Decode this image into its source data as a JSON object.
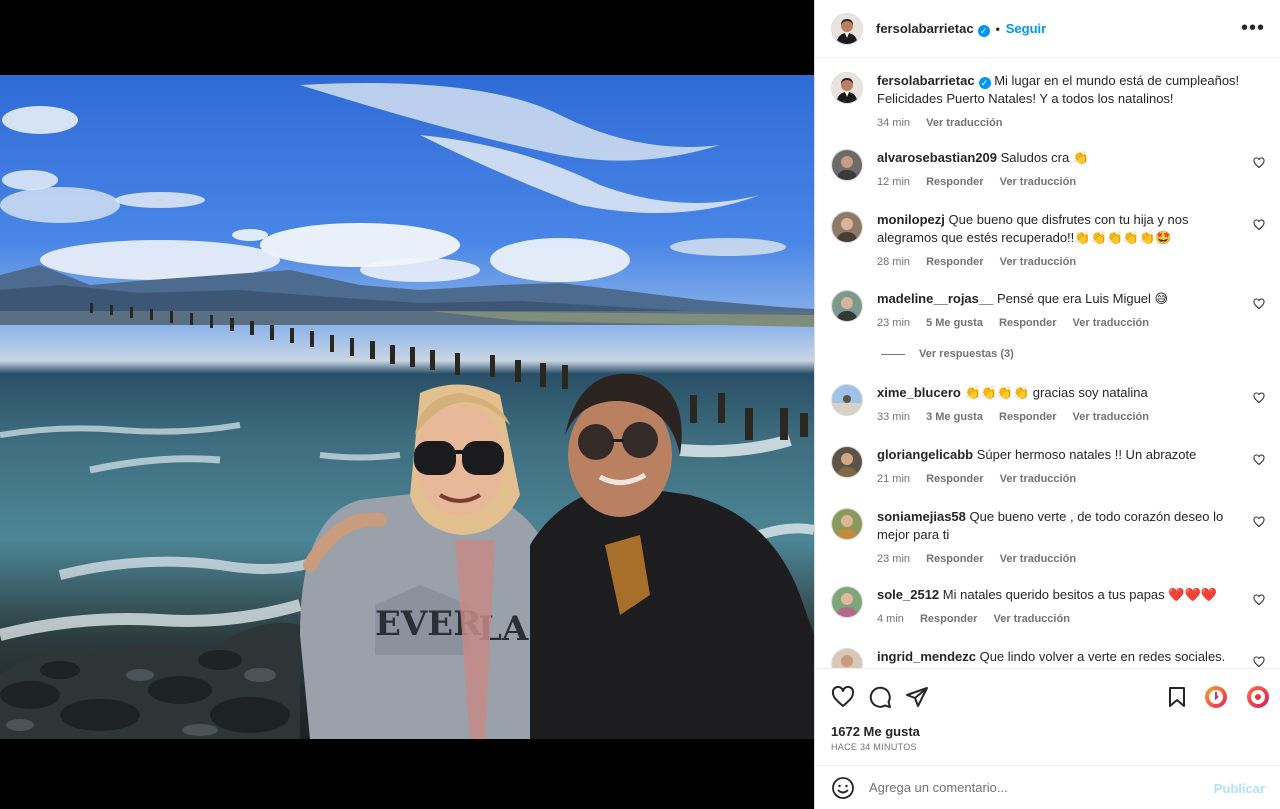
{
  "post": {
    "author": "fersolabarrietac",
    "follow_label": "Seguir",
    "dot": "•",
    "more_label": "•••",
    "verified_mark": "✓"
  },
  "caption": {
    "user": "fersolabarrietac",
    "text": "Mi lugar en el mundo está de cumpleaños! Felicidades Puerto Natales! Y a todos los natalinos!",
    "time": "34 min",
    "translate": "Ver traducción"
  },
  "comments": [
    {
      "user": "alvarosebastian209",
      "text": "Saludos cra 👏",
      "time": "12 min",
      "likes": "",
      "reply": "Responder",
      "translate": "Ver traducción"
    },
    {
      "user": "monilopezj",
      "text": "Que bueno que disfrutes con tu hija y nos alegramos que estés recuperado!!👏👏👏👏👏🤩",
      "time": "28 min",
      "likes": "",
      "reply": "Responder",
      "translate": "Ver traducción"
    },
    {
      "user": "madeline__rojas__",
      "text": "Pensé que era Luis Miguel 😅",
      "time": "23 min",
      "likes": "5 Me gusta",
      "reply": "Responder",
      "translate": "Ver traducción"
    },
    {
      "user": "xime_blucero",
      "text": "👏👏👏👏 gracias soy natalina",
      "time": "33 min",
      "likes": "3 Me gusta",
      "reply": "Responder",
      "translate": "Ver traducción"
    },
    {
      "user": "gloriangelicabb",
      "text": "Súper hermoso natales !! Un abrazote",
      "time": "21 min",
      "likes": "",
      "reply": "Responder",
      "translate": "Ver traducción"
    },
    {
      "user": "soniamejias58",
      "text": "Que bueno verte , de todo corazón deseo lo mejor para ti",
      "time": "23 min",
      "likes": "",
      "reply": "Responder",
      "translate": "Ver traducción"
    },
    {
      "user": "sole_2512",
      "text": "Mi natales querido besitos a tus papas ❤️❤️❤️",
      "time": "4 min",
      "likes": "",
      "reply": "Responder",
      "translate": "Ver traducción"
    },
    {
      "user": "ingrid_mendezc",
      "text": "Que lindo volver a verte en redes sociales.",
      "time": "",
      "likes": "",
      "reply": "",
      "translate": ""
    }
  ],
  "view_replies": "Ver respuestas (3)",
  "stats": {
    "likes": "1672 Me gusta",
    "time": "HACE 34 MINUTOS"
  },
  "composer": {
    "placeholder": "Agrega un comentario...",
    "publish_label": "Publicar"
  },
  "colors": {
    "link": "#0095f6",
    "muted": "#737373",
    "publish_disabled": "#b2dffc"
  }
}
